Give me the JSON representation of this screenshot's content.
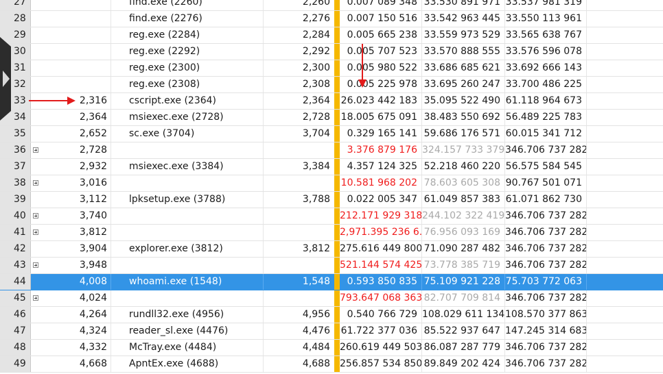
{
  "colors": {
    "selection": "#3394e6",
    "highlight_bar": "#f5b800",
    "negative_text": "#f01c1c",
    "muted_text": "#a9a9a9",
    "annotation_arrow": "#e21b1b"
  },
  "rows": [
    {
      "idx": "27",
      "expandable": false,
      "pid": "",
      "name": "find.exe (2260)",
      "num": "2,260",
      "v1": "0.007 089 348",
      "v2": "33.530 891 971",
      "v3": "33.537 981 319",
      "style": "normal"
    },
    {
      "idx": "28",
      "expandable": false,
      "pid": "",
      "name": "find.exe (2276)",
      "num": "2,276",
      "v1": "0.007 150 516",
      "v2": "33.542 963 445",
      "v3": "33.550 113 961",
      "style": "normal"
    },
    {
      "idx": "29",
      "expandable": false,
      "pid": "",
      "name": "reg.exe (2284)",
      "num": "2,284",
      "v1": "0.005 665 238",
      "v2": "33.559 973 529",
      "v3": "33.565 638 767",
      "style": "normal"
    },
    {
      "idx": "30",
      "expandable": false,
      "pid": "",
      "name": "reg.exe (2292)",
      "num": "2,292",
      "v1": "0.005 707 523",
      "v2": "33.570 888 555",
      "v3": "33.576 596 078",
      "style": "normal"
    },
    {
      "idx": "31",
      "expandable": false,
      "pid": "",
      "name": "reg.exe (2300)",
      "num": "2,300",
      "v1": "0.005 980 522",
      "v2": "33.686 685 621",
      "v3": "33.692 666 143",
      "style": "normal"
    },
    {
      "idx": "32",
      "expandable": false,
      "pid": "",
      "name": "reg.exe (2308)",
      "num": "2,308",
      "v1": "0.005 225 978",
      "v2": "33.695 260 247",
      "v3": "33.700 486 225",
      "style": "normal"
    },
    {
      "idx": "33",
      "expandable": false,
      "pid": "2,316",
      "name": "cscript.exe (2364)",
      "num": "2,364",
      "v1": "26.023 442 183",
      "v2": "35.095 522 490",
      "v3": "61.118 964 673",
      "style": "normal"
    },
    {
      "idx": "34",
      "expandable": false,
      "pid": "2,364",
      "name": "msiexec.exe (2728)",
      "num": "2,728",
      "v1": "18.005 675 091",
      "v2": "38.483 550 692",
      "v3": "56.489 225 783",
      "style": "normal"
    },
    {
      "idx": "35",
      "expandable": false,
      "pid": "2,652",
      "name": "sc.exe (3704)",
      "num": "3,704",
      "v1": "0.329 165 141",
      "v2": "59.686 176 571",
      "v3": "60.015 341 712",
      "style": "normal"
    },
    {
      "idx": "36",
      "expandable": true,
      "pid": "2,728",
      "name": "",
      "num": "",
      "v1": "3.376 879 176",
      "v2": "324.157 733 379",
      "v3": "346.706 737 282",
      "style": "orphan"
    },
    {
      "idx": "37",
      "expandable": false,
      "pid": "2,932",
      "name": "msiexec.exe (3384)",
      "num": "3,384",
      "v1": "4.357 124 325",
      "v2": "52.218 460 220",
      "v3": "56.575 584 545",
      "style": "normal"
    },
    {
      "idx": "38",
      "expandable": true,
      "pid": "3,016",
      "name": "",
      "num": "",
      "v1": "10.581 968 202",
      "v2": "78.603 605 308",
      "v3": "90.767 501 071",
      "style": "orphan"
    },
    {
      "idx": "39",
      "expandable": false,
      "pid": "3,112",
      "name": "lpksetup.exe (3788)",
      "num": "3,788",
      "v1": "0.022 005 347",
      "v2": "61.049 857 383",
      "v3": "61.071 862 730",
      "style": "normal"
    },
    {
      "idx": "40",
      "expandable": true,
      "pid": "3,740",
      "name": "",
      "num": "",
      "v1": "212.171 929 318",
      "v2": "244.102 322 419",
      "v3": "346.706 737 282",
      "style": "orphan"
    },
    {
      "idx": "41",
      "expandable": true,
      "pid": "3,812",
      "name": "",
      "num": "",
      "v1": "2,971.395 236 6...",
      "v2": "76.956 093 169",
      "v3": "346.706 737 282",
      "style": "orphan"
    },
    {
      "idx": "42",
      "expandable": false,
      "pid": "3,904",
      "name": "explorer.exe (3812)",
      "num": "3,812",
      "v1": "275.616 449 800",
      "v2": "71.090 287 482",
      "v3": "346.706 737 282",
      "style": "normal"
    },
    {
      "idx": "43",
      "expandable": true,
      "pid": "3,948",
      "name": "",
      "num": "",
      "v1": "521.144 574 425",
      "v2": "73.778 385 719",
      "v3": "346.706 737 282",
      "style": "orphan"
    },
    {
      "idx": "44",
      "expandable": false,
      "pid": "4,008",
      "name": "whoami.exe (1548)",
      "num": "1,548",
      "v1": "0.593 850 835",
      "v2": "75.109 921 228",
      "v3": "75.703 772 063",
      "style": "selected"
    },
    {
      "idx": "45",
      "expandable": true,
      "pid": "4,024",
      "name": "",
      "num": "",
      "v1": "793.647 068 363",
      "v2": "82.707 709 814",
      "v3": "346.706 737 282",
      "style": "orphan"
    },
    {
      "idx": "46",
      "expandable": false,
      "pid": "4,264",
      "name": "rundll32.exe (4956)",
      "num": "4,956",
      "v1": "0.540 766 729",
      "v2": "108.029 611 134",
      "v3": "108.570 377 863",
      "style": "normal"
    },
    {
      "idx": "47",
      "expandable": false,
      "pid": "4,324",
      "name": "reader_sl.exe (4476)",
      "num": "4,476",
      "v1": "61.722 377 036",
      "v2": "85.522 937 647",
      "v3": "147.245 314 683",
      "style": "normal"
    },
    {
      "idx": "48",
      "expandable": false,
      "pid": "4,332",
      "name": "McTray.exe (4484)",
      "num": "4,484",
      "v1": "260.619 449 503",
      "v2": "86.087 287 779",
      "v3": "346.706 737 282",
      "style": "normal"
    },
    {
      "idx": "49",
      "expandable": false,
      "pid": "4,668",
      "name": "ApntEx.exe (4688)",
      "num": "4,688",
      "v1": "256.857 534 850",
      "v2": "89.849 202 424",
      "v3": "346.706 737 282",
      "style": "normal"
    }
  ]
}
